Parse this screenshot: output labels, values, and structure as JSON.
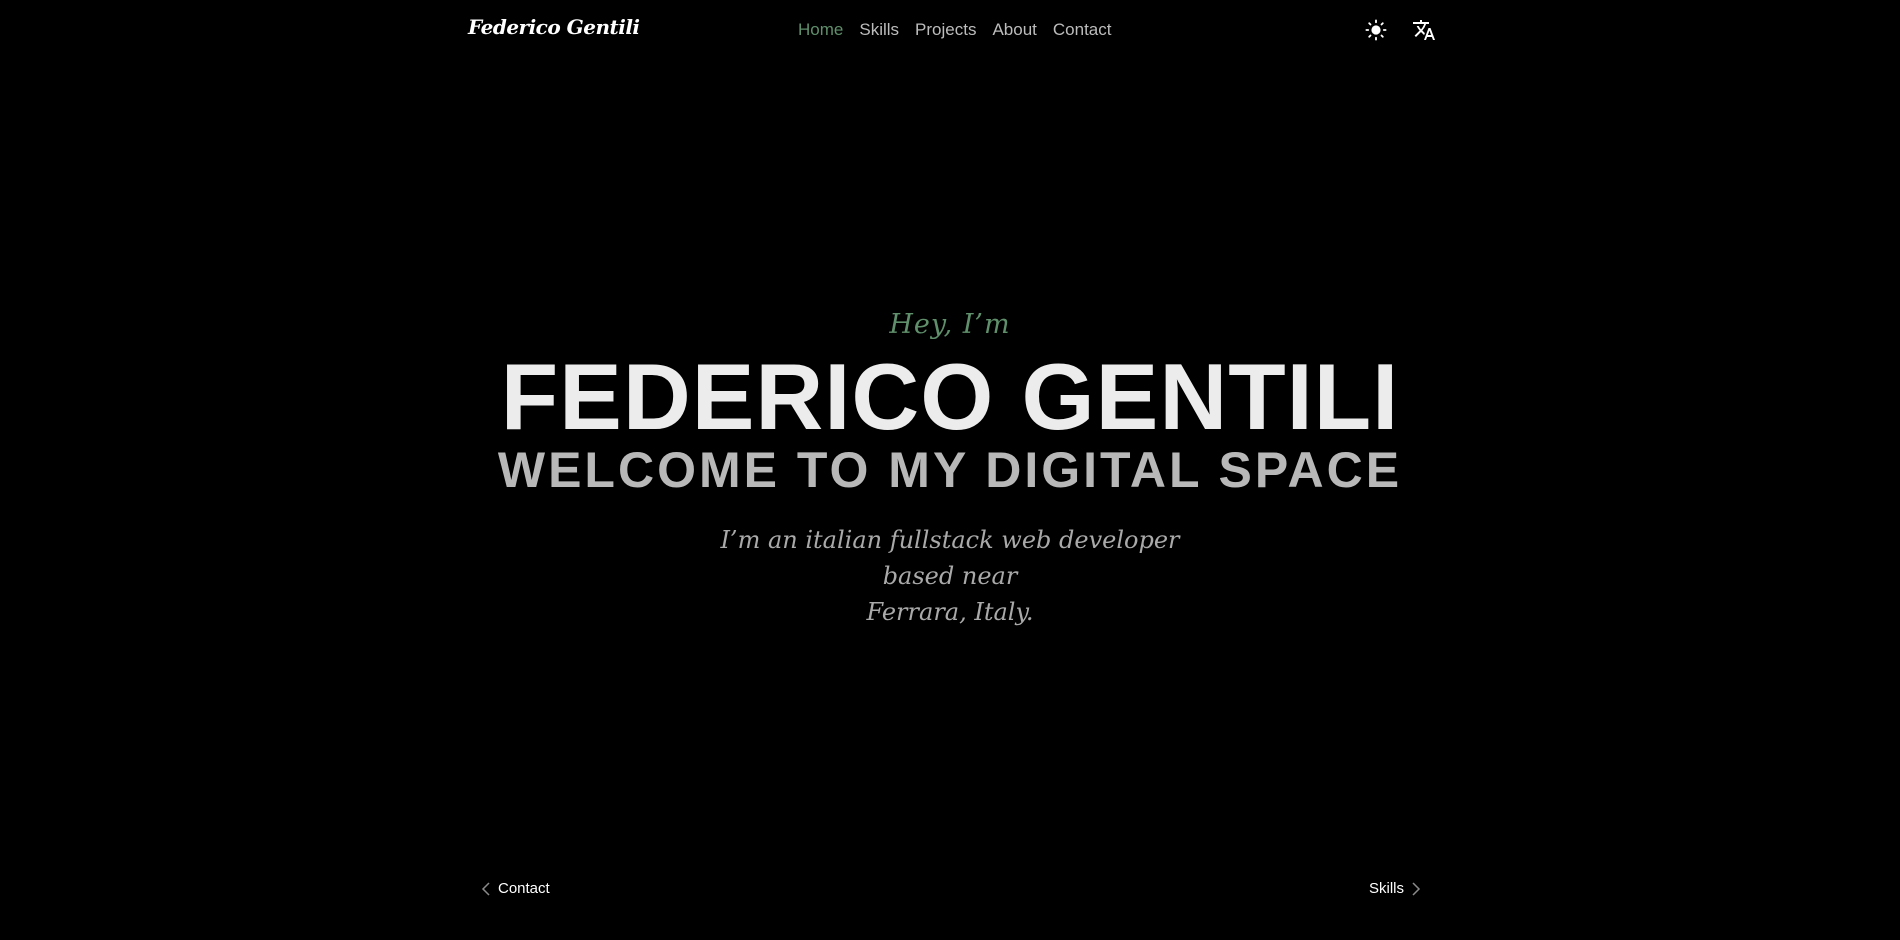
{
  "header": {
    "brand": "Federico Gentili",
    "nav": [
      {
        "label": "Home",
        "active": true
      },
      {
        "label": "Skills",
        "active": false
      },
      {
        "label": "Projects",
        "active": false
      },
      {
        "label": "About",
        "active": false
      },
      {
        "label": "Contact",
        "active": false
      }
    ],
    "icons": {
      "theme": "sun-icon",
      "language": "translate-icon"
    }
  },
  "hero": {
    "greeting": "Hey, I’m",
    "name": "FEDERICO GENTILI",
    "tagline": "WELCOME TO MY DIGITAL SPACE",
    "intro_line1": "I’m an italian fullstack web developer based near",
    "intro_line2": "Ferrara, Italy."
  },
  "pager": {
    "prev_label": "Contact",
    "next_label": "Skills"
  },
  "colors": {
    "background": "#000000",
    "accent": "#5f8f6b",
    "nav_text": "#bcbcbc",
    "heading": "#ececec",
    "subheading": "#b8b8b8"
  }
}
